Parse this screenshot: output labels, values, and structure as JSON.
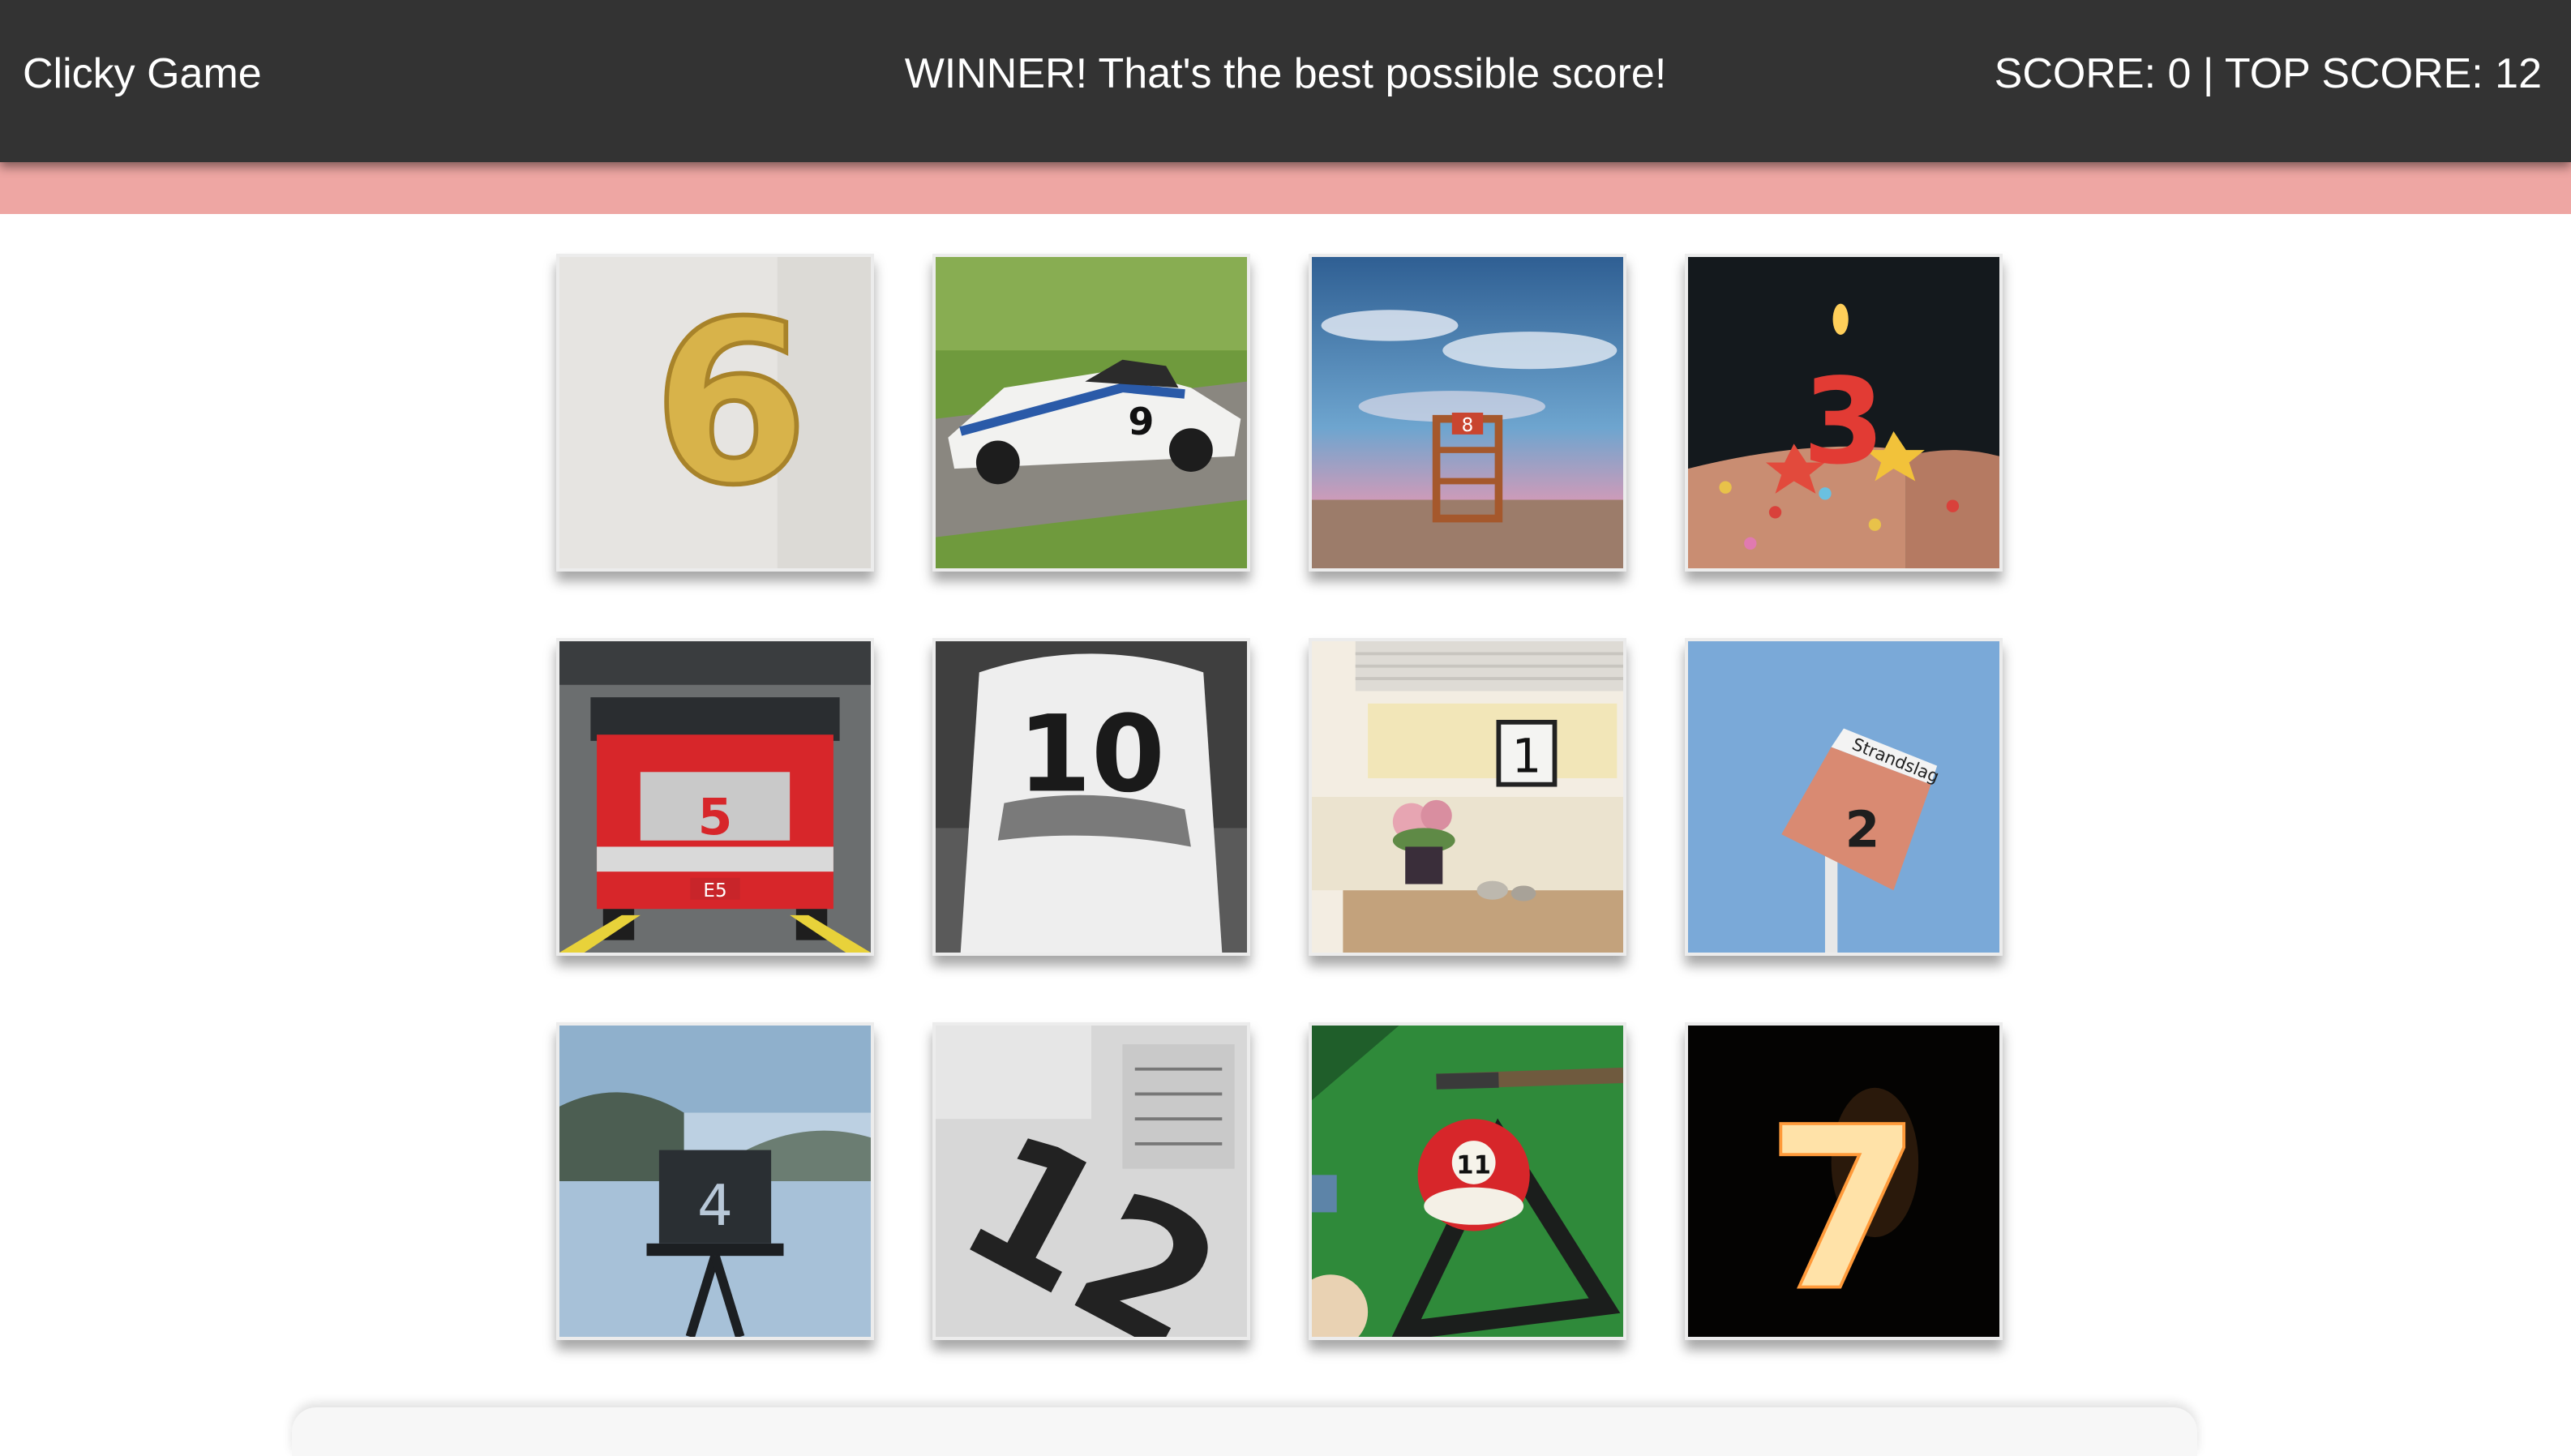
{
  "header": {
    "brand": "Clicky Game",
    "message": "WINNER! That's the best possible score!",
    "score_text": "SCORE: 0 | TOP SCORE: 12"
  },
  "colors": {
    "navbar": "#333333",
    "accent_bar": "#eea6a3"
  },
  "tiles": [
    {
      "name": "tile-gold-balloon-six",
      "number_label": "6"
    },
    {
      "name": "tile-race-car-nine",
      "number_label": "9"
    },
    {
      "name": "tile-lifeguard-tower-eight",
      "number_label": "8"
    },
    {
      "name": "tile-birthday-cake-three",
      "number_label": "3"
    },
    {
      "name": "tile-fire-truck-five",
      "number_label": "5",
      "plate": "E5"
    },
    {
      "name": "tile-jersey-ten",
      "number_label": "10"
    },
    {
      "name": "tile-window-sign-one",
      "number_label": "1"
    },
    {
      "name": "tile-beach-sign-two",
      "number_label": "2",
      "sign_text": "Strandslag"
    },
    {
      "name": "tile-lake-lamp-four",
      "number_label": "4"
    },
    {
      "name": "tile-newspaper-twelve",
      "number_label": "12"
    },
    {
      "name": "tile-billiard-ball-eleven",
      "number_label": "11"
    },
    {
      "name": "tile-sparkler-seven",
      "number_label": "7"
    }
  ]
}
